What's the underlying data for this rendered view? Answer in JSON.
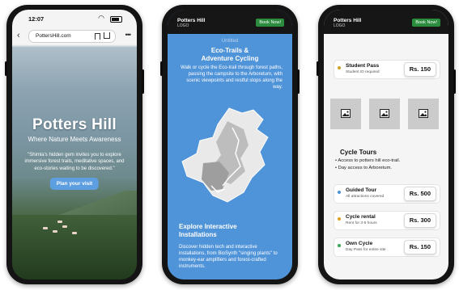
{
  "phone1": {
    "status_time": "12:07",
    "url": "PottersHill.com",
    "hero_title": "Potters Hill",
    "hero_subtitle": "Where Nature Meets Awareness",
    "hero_description": "\"Shimla's hidden gem invites you to explore immersive forest trails, meditative spaces, and eco-stories waiting to be discovered.\"",
    "cta_label": "Plan your visit"
  },
  "phone2": {
    "brand": "Potters Hill",
    "logo_text": "LOGO",
    "book_label": "Book Now!",
    "faded_label": "Untitled",
    "section1_title": "Eco-Trails &\nAdventure Cycling",
    "section1_text": "Walk or cycle the Eco-trail through forest paths, passing the campsite to the Arboretum, with scenic viewpoints and restful stops along the way.",
    "section2_title": "Explore Interactive\nInstallations",
    "section2_text": "Discover hidden tech and interactive installations, from BioSynth \"singing plants\" to monkey-ear amplifiers and forest-crafted instruments."
  },
  "phone3": {
    "brand": "Potters Hill",
    "logo_text": "LOGO",
    "book_label": "Book Now!",
    "cycle_title": "Cycle Tours",
    "bullets": [
      "Access to potters hill eco-trail.",
      "Day access to Arboretum."
    ],
    "passes": [
      {
        "title": "Student Pass",
        "subtitle": "Student ID required",
        "price": "Rs. 150",
        "dot_color": "#c9a227"
      },
      {
        "title": "Guided Tour",
        "subtitle": "All attractions covered",
        "price": "Rs. 500",
        "dot_color": "#4f93d8"
      },
      {
        "title": "Cycle rental",
        "subtitle": "Rent for 3-5 hours",
        "price": "Rs. 300",
        "dot_color": "#e0a020"
      },
      {
        "title": "Own Cycle",
        "subtitle": "Day Pass for entire site",
        "price": "Rs. 150",
        "dot_color": "#3aa655"
      }
    ]
  },
  "colors": {
    "hero_button": "#5d9ee0",
    "blue_bg": "#4f93d8",
    "book_green": "#2a8c3c",
    "nav_dark": "#161616"
  }
}
